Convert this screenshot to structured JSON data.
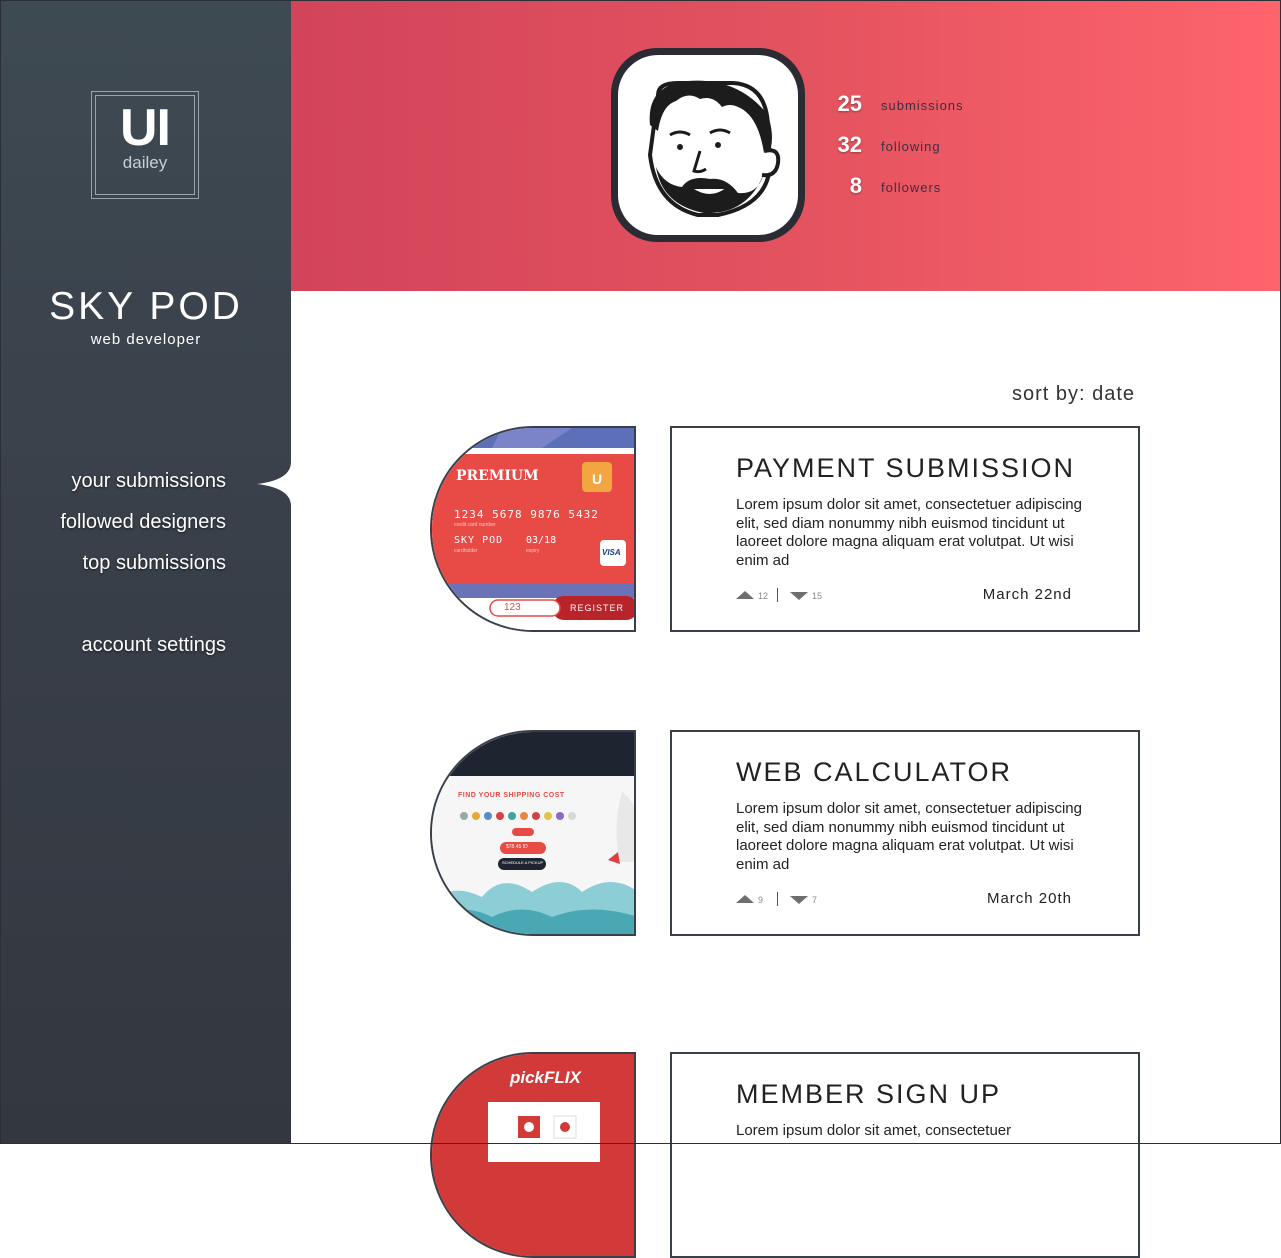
{
  "logo": {
    "mark": "UI",
    "sub": "dailey"
  },
  "profile": {
    "name": "SKY POD",
    "role": "web developer"
  },
  "nav": {
    "items": [
      "your submissions",
      "followed designers",
      "top submissions"
    ],
    "settings": "account settings"
  },
  "stats": [
    {
      "value": "25",
      "label": "submissions"
    },
    {
      "value": "32",
      "label": "following"
    },
    {
      "value": "8",
      "label": "followers"
    }
  ],
  "sort": {
    "label": "sort by: date"
  },
  "submissions": [
    {
      "title": "PAYMENT SUBMISSION",
      "text": "Lorem ipsum dolor sit amet, consectetuer adipiscing elit, sed diam nonummy nibh euismod tincidunt ut laoreet dolore magna aliquam erat volutpat. Ut wisi enim ad",
      "upvotes": "12",
      "downvotes": "15",
      "date": "March 22nd"
    },
    {
      "title": "WEB CALCULATOR",
      "text": "Lorem ipsum dolor sit amet, consectetuer adipiscing elit, sed diam nonummy nibh euismod tincidunt ut laoreet dolore magna aliquam erat volutpat. Ut wisi enim ad",
      "upvotes": "9",
      "downvotes": "7",
      "date": "March 20th"
    },
    {
      "title": "MEMBER SIGN UP",
      "text": "Lorem ipsum dolor sit amet, consectetuer",
      "upvotes": "",
      "downvotes": "",
      "date": ""
    }
  ],
  "thumbnails": {
    "card": {
      "brand": "PREMIUM",
      "number": "1234 5678 9876 5432",
      "holder": "SKY POD",
      "expiry": "03/18",
      "cvv": "123",
      "button": "REGISTER",
      "network": "VISA",
      "number_caption": "credit card number",
      "holder_caption": "cardholder",
      "expiry_caption": "expiry"
    },
    "calc": {
      "heading": "FIND YOUR SHIPPING COST",
      "price": "$78.45 ID",
      "button": "SCHEDULE A PICKUP"
    },
    "flix": {
      "brand": "pickFLIX"
    }
  },
  "colors": {
    "sidebar": "#3b434b",
    "header_start": "#d2445a",
    "header_end": "#fe646c",
    "ink": "#39404a"
  }
}
